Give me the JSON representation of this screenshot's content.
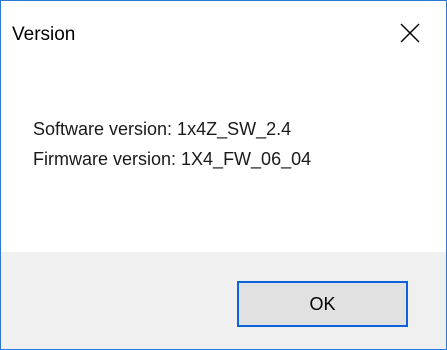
{
  "dialog": {
    "title": "Version",
    "close_icon": "close-icon",
    "software_version": "Software version: 1x4Z_SW_2.4",
    "firmware_version": "Firmware version: 1X4_FW_06_04",
    "ok_label": "OK"
  },
  "colors": {
    "border": "#2b79d0",
    "footer_bg": "#f0f0f0",
    "button_border": "#0a63d8",
    "button_bg": "#e1e1e1"
  }
}
